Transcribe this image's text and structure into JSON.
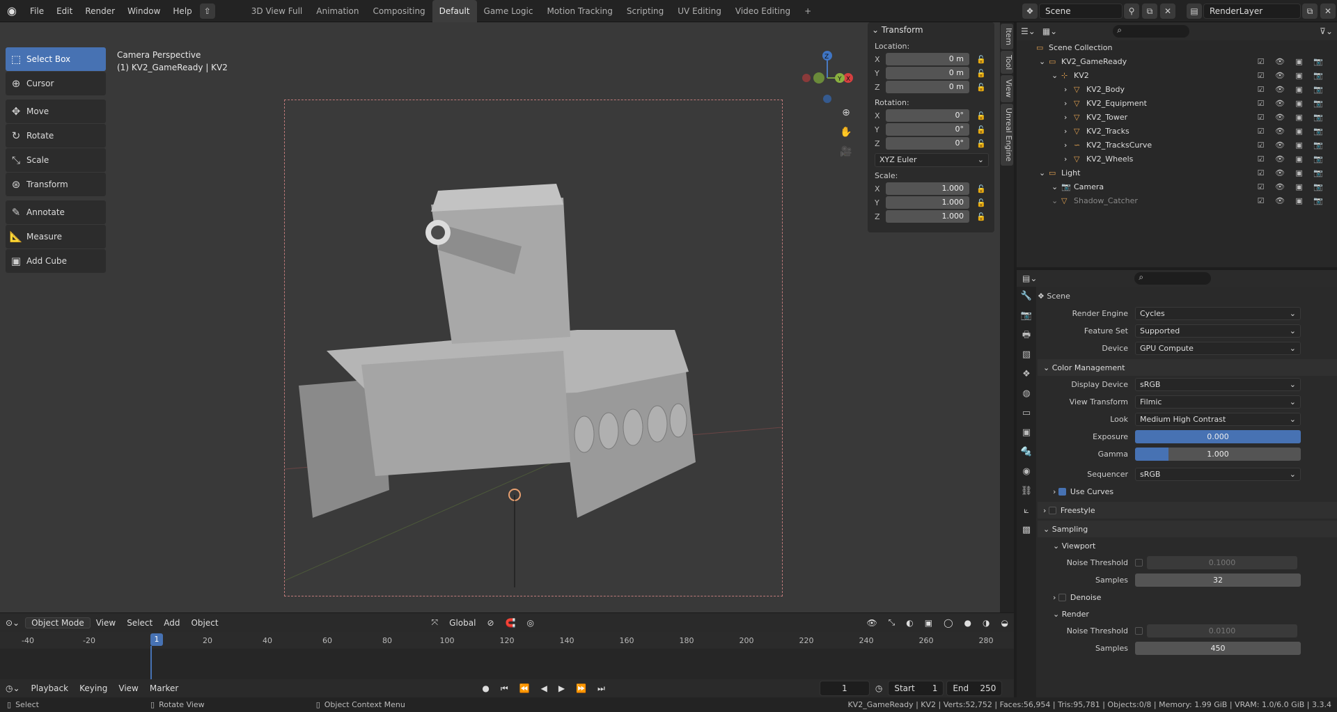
{
  "topbar": {
    "menus": [
      "File",
      "Edit",
      "Render",
      "Window",
      "Help"
    ],
    "workspaces": [
      "3D View Full",
      "Animation",
      "Compositing",
      "Default",
      "Game Logic",
      "Motion Tracking",
      "Scripting",
      "UV Editing",
      "Video Editing"
    ],
    "active_workspace": "Default",
    "add_tab": "+",
    "scene": "Scene",
    "view_layer": "RenderLayer"
  },
  "toolshelf": {
    "tools": [
      {
        "label": "Select Box",
        "icon": "select-box-icon",
        "glyph": "⬚",
        "active": true
      },
      {
        "label": "Cursor",
        "icon": "cursor-icon",
        "glyph": "⊕",
        "active": false
      },
      {
        "label": "Move",
        "icon": "move-icon",
        "glyph": "✥",
        "active": false
      },
      {
        "label": "Rotate",
        "icon": "rotate-icon",
        "glyph": "↻",
        "active": false
      },
      {
        "label": "Scale",
        "icon": "scale-icon",
        "glyph": "⤡",
        "active": false
      },
      {
        "label": "Transform",
        "icon": "transform-icon",
        "glyph": "⊛",
        "active": false
      },
      {
        "label": "Annotate",
        "icon": "annotate-icon",
        "glyph": "✎",
        "active": false
      },
      {
        "label": "Measure",
        "icon": "measure-icon",
        "glyph": "📐",
        "active": false
      },
      {
        "label": "Add Cube",
        "icon": "add-cube-icon",
        "glyph": "▣",
        "active": false
      }
    ]
  },
  "viewport": {
    "header_line1": "Camera Perspective",
    "header_line2": "(1) KV2_GameReady | KV2"
  },
  "npanel": {
    "title": "Transform",
    "location_label": "Location:",
    "location": [
      {
        "axis": "X",
        "value": "0 m"
      },
      {
        "axis": "Y",
        "value": "0 m"
      },
      {
        "axis": "Z",
        "value": "0 m"
      }
    ],
    "rotation_label": "Rotation:",
    "rotation": [
      {
        "axis": "X",
        "value": "0°"
      },
      {
        "axis": "Y",
        "value": "0°"
      },
      {
        "axis": "Z",
        "value": "0°"
      }
    ],
    "rotation_mode": "XYZ Euler",
    "scale_label": "Scale:",
    "scale": [
      {
        "axis": "X",
        "value": "1.000"
      },
      {
        "axis": "Y",
        "value": "1.000"
      },
      {
        "axis": "Z",
        "value": "1.000"
      }
    ]
  },
  "side_tabs": [
    "Item",
    "Tool",
    "View",
    "Unreal Engine"
  ],
  "vp_footer": {
    "mode": "Object Mode",
    "menus": [
      "View",
      "Select",
      "Add",
      "Object"
    ],
    "orientation": "Global"
  },
  "timeline": {
    "ticks": [
      "-40",
      "-20",
      "1",
      "20",
      "40",
      "60",
      "80",
      "100",
      "120",
      "140",
      "160",
      "180",
      "200",
      "220",
      "240",
      "260",
      "280"
    ],
    "current_frame": "1",
    "menus": [
      "Playback",
      "Keying",
      "View",
      "Marker"
    ],
    "frame_field": "1",
    "start_label": "Start",
    "start": "1",
    "end_label": "End",
    "end": "250"
  },
  "statusbar": {
    "left1": "Select",
    "left2": "Rotate View",
    "left3": "Object Context Menu",
    "stats": "KV2_GameReady | KV2 | Verts:52,752 | Faces:56,954 | Tris:95,781 | Objects:0/8 | Memory: 1.99 GiB | VRAM: 1.0/6.0 GiB | 3.3.4"
  },
  "outliner": {
    "rows": [
      {
        "label": "Scene Collection",
        "indent": 0,
        "icon": "collection-icon"
      },
      {
        "label": "KV2_GameReady",
        "indent": 1,
        "icon": "collection-icon"
      },
      {
        "label": "KV2",
        "indent": 2,
        "icon": "empty-icon"
      },
      {
        "label": "KV2_Body",
        "indent": 3,
        "icon": "mesh-icon"
      },
      {
        "label": "KV2_Equipment",
        "indent": 3,
        "icon": "mesh-icon"
      },
      {
        "label": "KV2_Tower",
        "indent": 3,
        "icon": "mesh-icon"
      },
      {
        "label": "KV2_Tracks",
        "indent": 3,
        "icon": "mesh-icon"
      },
      {
        "label": "KV2_TracksCurve",
        "indent": 3,
        "icon": "curve-icon"
      },
      {
        "label": "KV2_Wheels",
        "indent": 3,
        "icon": "mesh-icon"
      },
      {
        "label": "Light",
        "indent": 1,
        "icon": "collection-icon"
      },
      {
        "label": "Camera",
        "indent": 2,
        "icon": "camera-icon"
      },
      {
        "label": "Shadow_Catcher",
        "indent": 2,
        "icon": "mesh-icon"
      }
    ]
  },
  "properties": {
    "context": "Scene",
    "render_engine_label": "Render Engine",
    "render_engine": "Cycles",
    "feature_set_label": "Feature Set",
    "feature_set": "Supported",
    "device_label": "Device",
    "device": "GPU Compute",
    "color_mgmt": "Color Management",
    "display_device_label": "Display Device",
    "display_device": "sRGB",
    "view_transform_label": "View Transform",
    "view_transform": "Filmic",
    "look_label": "Look",
    "look": "Medium High Contrast",
    "exposure_label": "Exposure",
    "exposure": "0.000",
    "gamma_label": "Gamma",
    "gamma": "1.000",
    "sequencer_label": "Sequencer",
    "sequencer": "sRGB",
    "use_curves": "Use Curves",
    "freestyle": "Freestyle",
    "sampling": "Sampling",
    "viewport": "Viewport",
    "noise_threshold_label": "Noise Threshold",
    "vp_noise_threshold": "0.1000",
    "samples_label": "Samples",
    "vp_samples": "32",
    "denoise": "Denoise",
    "render": "Render",
    "r_noise_threshold": "0.0100",
    "r_samples": "450"
  },
  "colors": {
    "accent": "#4772b3",
    "bg": "#393939",
    "panel": "#2b2b2b"
  }
}
